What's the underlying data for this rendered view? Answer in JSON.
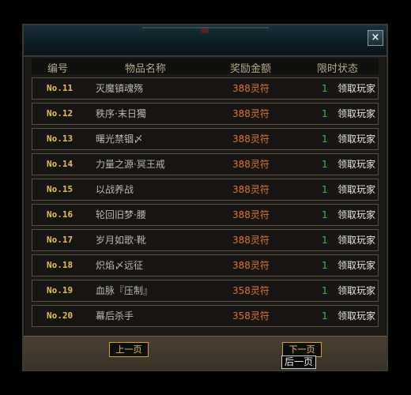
{
  "window": {
    "close_label": "×"
  },
  "columns": {
    "no": "编号",
    "name": "物品名称",
    "reward": "奖励金额",
    "status": "限时状态"
  },
  "rows": [
    {
      "no": "No.11",
      "name": "灭魔镇魂殇",
      "reward": "388灵符",
      "count": "1",
      "action": "领取玩家"
    },
    {
      "no": "No.12",
      "name": "秩序·末日獨",
      "reward": "388灵符",
      "count": "1",
      "action": "领取玩家"
    },
    {
      "no": "No.13",
      "name": "曙光禁锢〆",
      "reward": "388灵符",
      "count": "1",
      "action": "领取玩家"
    },
    {
      "no": "No.14",
      "name": "力量之源·冥王戒",
      "reward": "388灵符",
      "count": "1",
      "action": "领取玩家"
    },
    {
      "no": "No.15",
      "name": "以战养战",
      "reward": "388灵符",
      "count": "1",
      "action": "领取玩家"
    },
    {
      "no": "No.16",
      "name": "轮回旧梦·腰",
      "reward": "388灵符",
      "count": "1",
      "action": "领取玩家"
    },
    {
      "no": "No.17",
      "name": "岁月如歌·靴",
      "reward": "388灵符",
      "count": "1",
      "action": "领取玩家"
    },
    {
      "no": "No.18",
      "name": "炽焰〆远征",
      "reward": "388灵符",
      "count": "1",
      "action": "领取玩家"
    },
    {
      "no": "No.19",
      "name": "血脉『压制』",
      "reward": "358灵符",
      "count": "1",
      "action": "领取玩家"
    },
    {
      "no": "No.20",
      "name": "幕后杀手",
      "reward": "358灵符",
      "count": "1",
      "action": "领取玩家"
    }
  ],
  "footer": {
    "prev_label": "上一页",
    "next_label": "下一页",
    "tooltip": "后一页"
  }
}
